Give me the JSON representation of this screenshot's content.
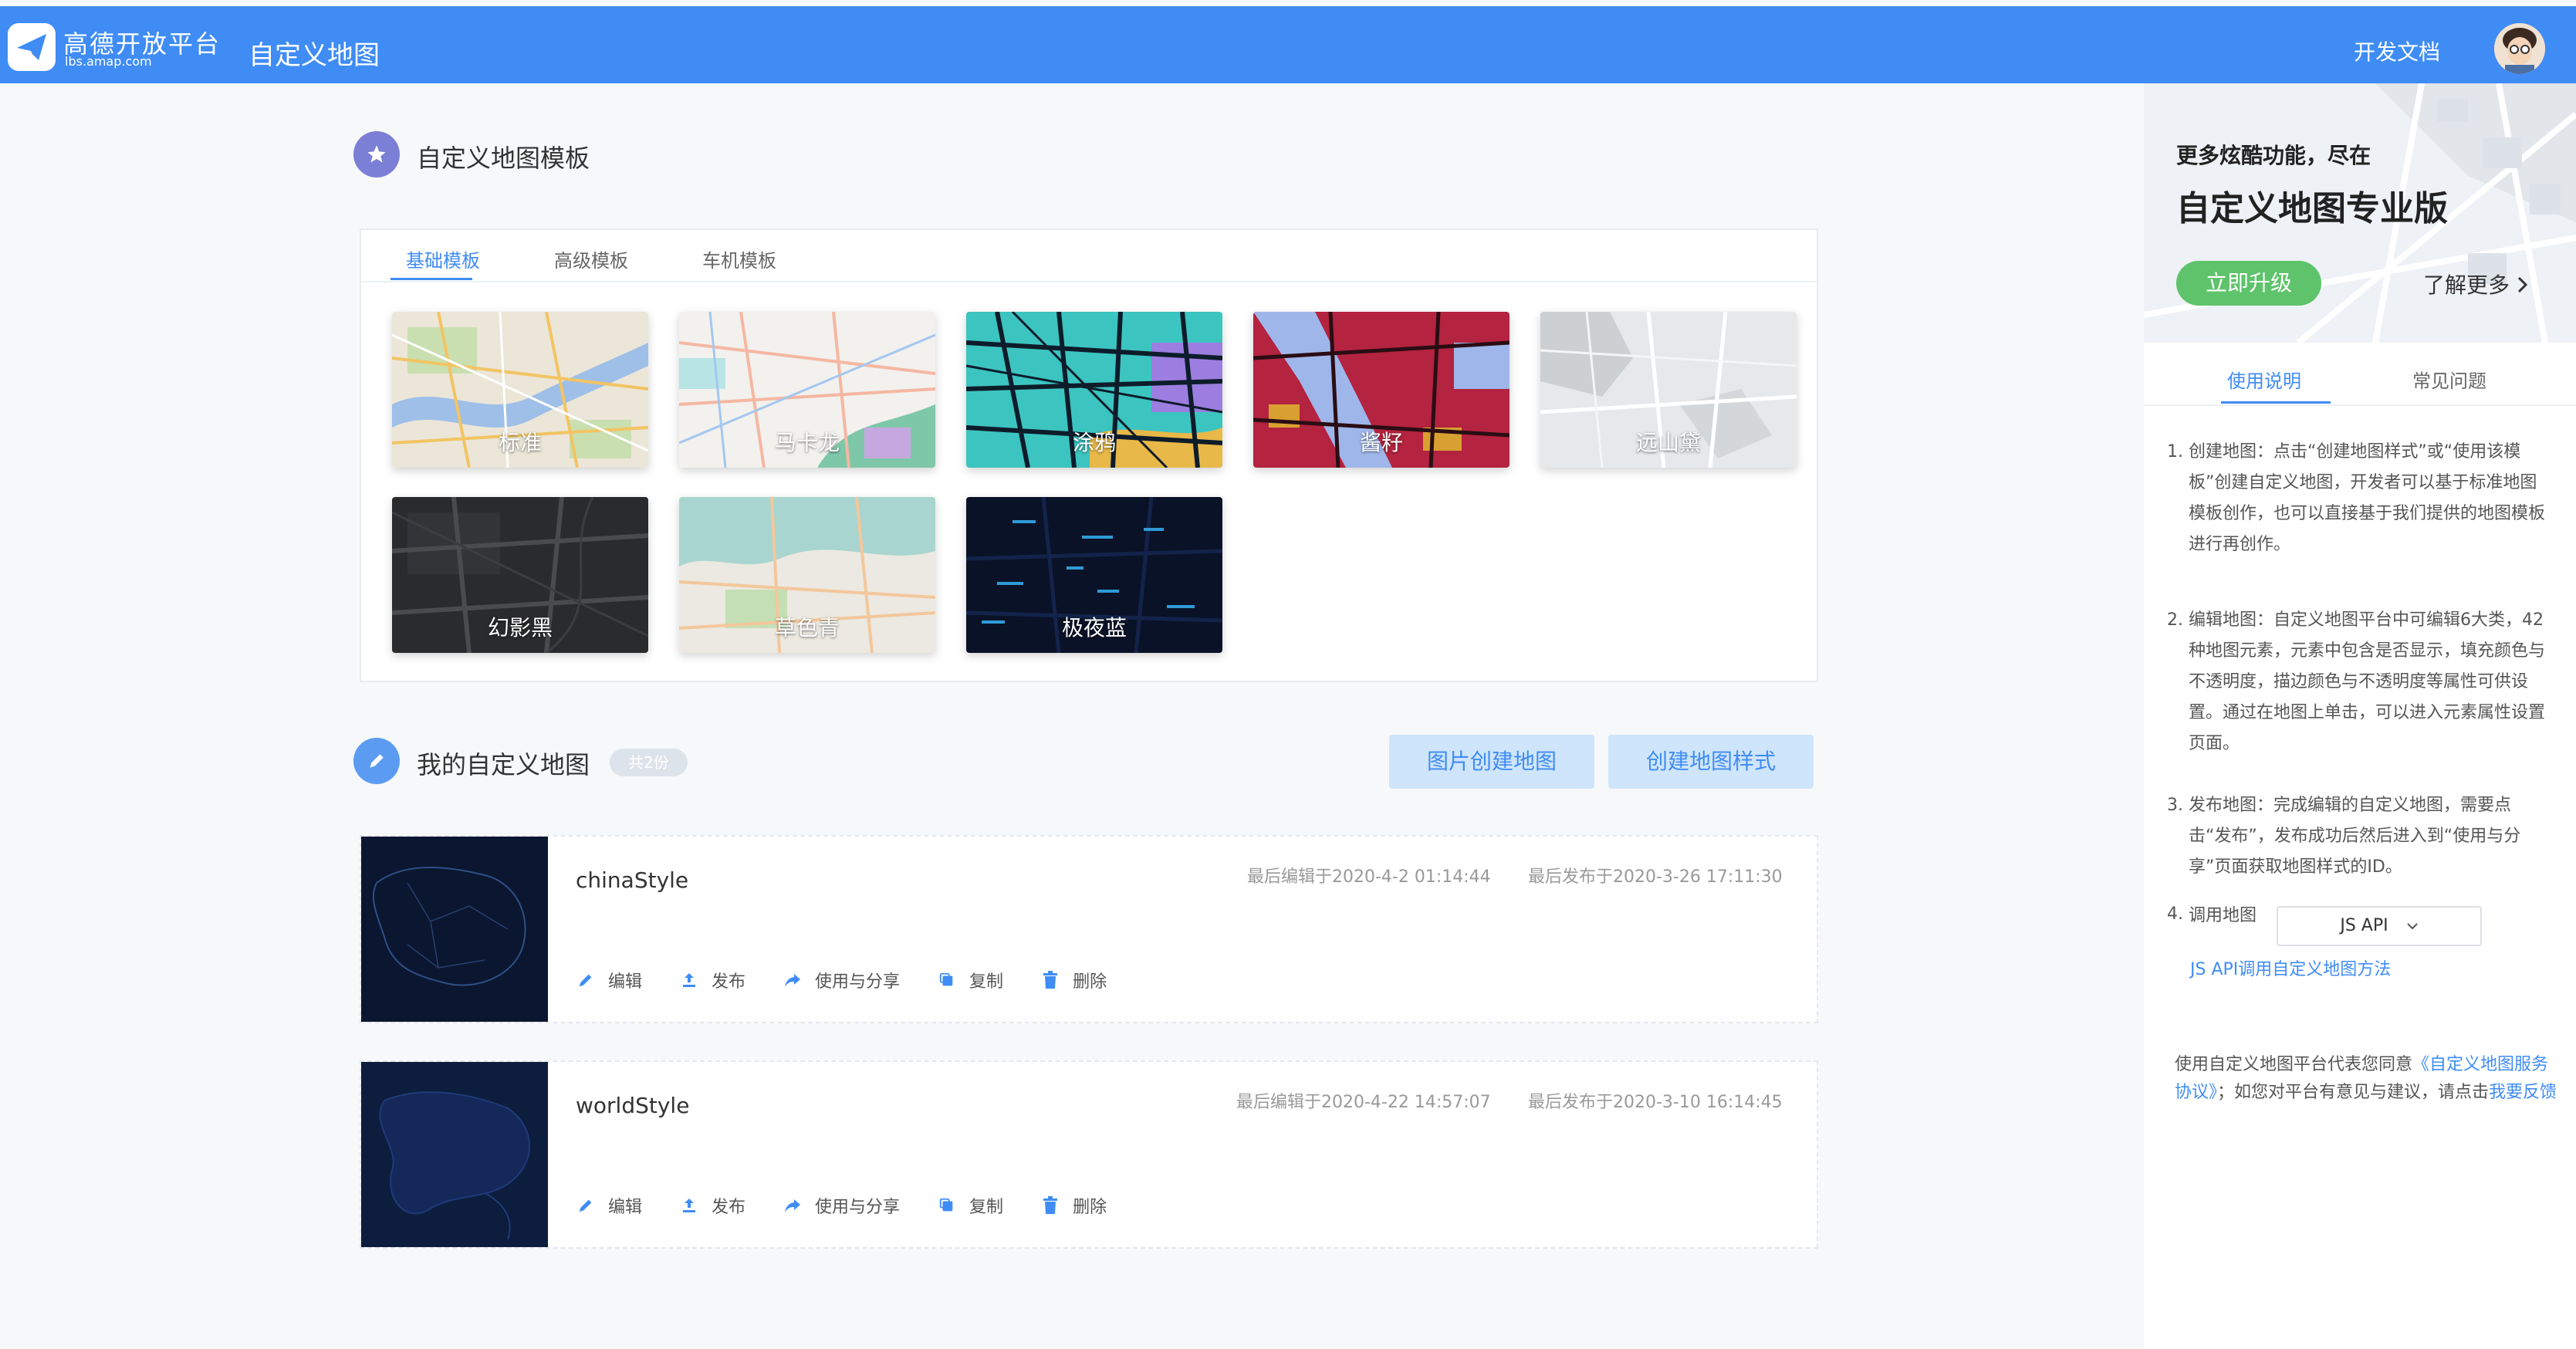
{
  "header": {
    "brand_name": "高德开放平台",
    "brand_url": "lbs.amap.com",
    "app_title": "自定义地图",
    "dev_docs": "开发文档"
  },
  "templates_section": {
    "title": "自定义地图模板",
    "tabs": [
      "基础模板",
      "高级模板",
      "车机模板"
    ],
    "active_tab": "基础模板",
    "cards": [
      {
        "label": "标准"
      },
      {
        "label": "马卡龙"
      },
      {
        "label": "涂鸦"
      },
      {
        "label": "酱籽"
      },
      {
        "label": "远山黛"
      },
      {
        "label": "幻影黑"
      },
      {
        "label": "草色青"
      },
      {
        "label": "极夜蓝"
      }
    ]
  },
  "my_maps": {
    "title": "我的自定义地图",
    "count_badge": "共2份",
    "btn_image_create": "图片创建地图",
    "btn_create_style": "创建地图样式",
    "actions": {
      "edit": "编辑",
      "publish": "发布",
      "use_share": "使用与分享",
      "copy": "复制",
      "delete": "删除"
    },
    "maps": [
      {
        "name": "chinaStyle",
        "last_edit": "最后编辑于2020-4-2 01:14:44",
        "last_publish": "最后发布于2020-3-26 17:11:30"
      },
      {
        "name": "worldStyle",
        "last_edit": "最后编辑于2020-4-22 14:57:07",
        "last_publish": "最后发布于2020-3-10 16:14:45"
      }
    ]
  },
  "side_panel": {
    "promo_small": "更多炫酷功能，尽在",
    "promo_big": "自定义地图专业版",
    "upgrade_button": "立即升级",
    "learn_more": "了解更多",
    "tabs": [
      "使用说明",
      "常见问题"
    ],
    "instructions": [
      {
        "num": "1.",
        "text": "创建地图：点击“创建地图样式”或“使用该模板”创建自定义地图，开发者可以基于标准地图模板创作，也可以直接基于我们提供的地图模板进行再创作。"
      },
      {
        "num": "2.",
        "text": "编辑地图：自定义地图平台中可编辑6大类，42种地图元素，元素中包含是否显示，填充颜色与不透明度，描边颜色与不透明度等属性可供设置。通过在地图上单击，可以进入元素属性设置页面。"
      },
      {
        "num": "3.",
        "text": "发布地图：完成编辑的自定义地图，需要点击“发布”，发布成功后然后进入到“使用与分享”页面获取地图样式的ID。"
      }
    ],
    "call_num": "4.",
    "call_label": "调用地图",
    "call_select": "JS API",
    "js_link": "JS API调用自定义地图方法",
    "agree_prefix": "使用自定义地图平台代表您同意",
    "agree_link": "《自定义地图服务协议》",
    "agree_mid": "；如您对平台有意见与建议，请点击",
    "feedback_link": "我要反馈"
  },
  "colors": {
    "primary": "#3f8cf5",
    "upgrade_green": "#5ec36a",
    "light_button": "#cfe5fb",
    "section_icon_purple": "#7b7fd6",
    "section_icon_blue": "#5b9cf2"
  }
}
